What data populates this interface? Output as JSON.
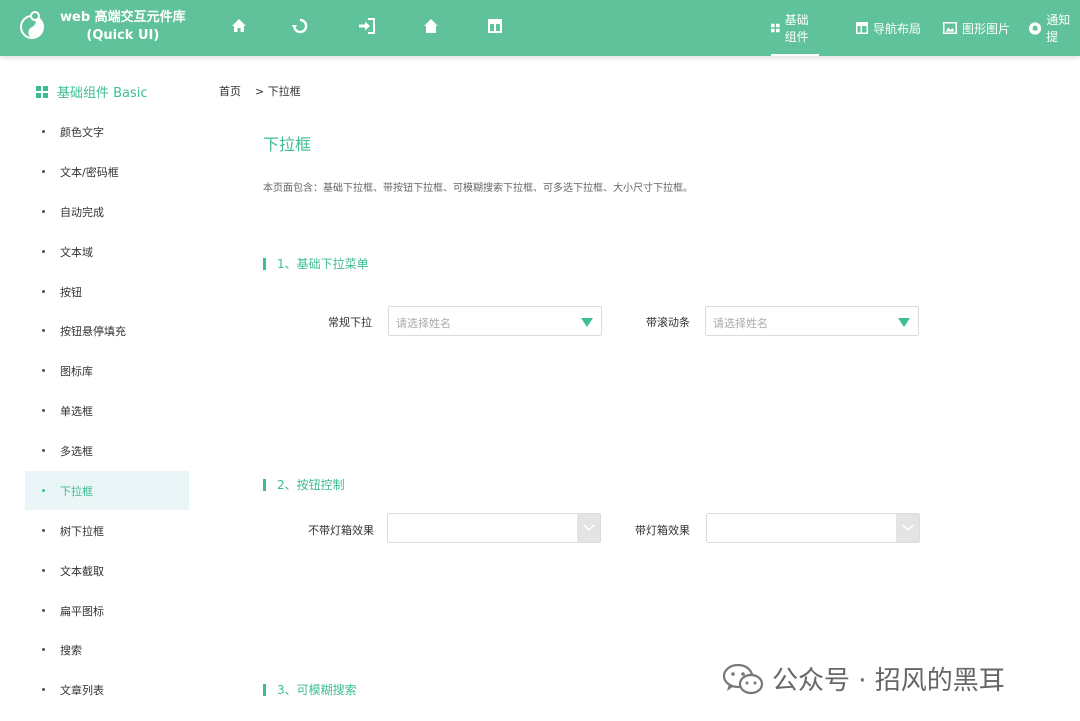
{
  "header": {
    "brand_line1": "web 高端交互元件库",
    "brand_line2": "(Quick UI)",
    "nav": [
      {
        "label": "基础组件",
        "icon": "grid-icon"
      },
      {
        "label": "导航布局",
        "icon": "layout-icon"
      },
      {
        "label": "图形图片",
        "icon": "image-icon"
      },
      {
        "label": "通知提",
        "icon": "bell-icon"
      }
    ],
    "tool_icons": [
      "home-icon",
      "undo-icon",
      "login-icon",
      "home-icon",
      "layout-icon"
    ]
  },
  "sidebar": {
    "title": "基础组件 Basic",
    "items": [
      {
        "label": "颜色文字"
      },
      {
        "label": "文本/密码框"
      },
      {
        "label": "自动完成"
      },
      {
        "label": "文本域"
      },
      {
        "label": "按钮"
      },
      {
        "label": "按钮悬停填充"
      },
      {
        "label": "图标库"
      },
      {
        "label": "单选框"
      },
      {
        "label": "多选框"
      },
      {
        "label": "下拉框",
        "active": true
      },
      {
        "label": "树下拉框"
      },
      {
        "label": "文本截取"
      },
      {
        "label": "扁平图标"
      },
      {
        "label": "搜索"
      },
      {
        "label": "文章列表"
      }
    ]
  },
  "breadcrumb": {
    "home": "首页",
    "current": "> 下拉框"
  },
  "page": {
    "title": "下拉框",
    "description": "本页面包含：基础下拉框、带按钮下拉框、可模糊搜索下拉框、可多选下拉框、大小尺寸下拉框。"
  },
  "sections": [
    {
      "title": "1、基础下拉菜单",
      "fields": [
        {
          "label": "常规下拉",
          "placeholder": "请选择姓名"
        },
        {
          "label": "带滚动条",
          "placeholder": "请选择姓名"
        }
      ]
    },
    {
      "title": "2、按钮控制",
      "fields": [
        {
          "label": "不带灯箱效果",
          "placeholder": ""
        },
        {
          "label": "带灯箱效果",
          "placeholder": ""
        }
      ]
    },
    {
      "title": "3、可模糊搜索"
    }
  ],
  "watermark": {
    "text": "公众号 · 招风的黑耳"
  },
  "colors": {
    "header": "#5fc29a",
    "accent": "#3ebd93",
    "active_bg": "#e9f5f6"
  }
}
